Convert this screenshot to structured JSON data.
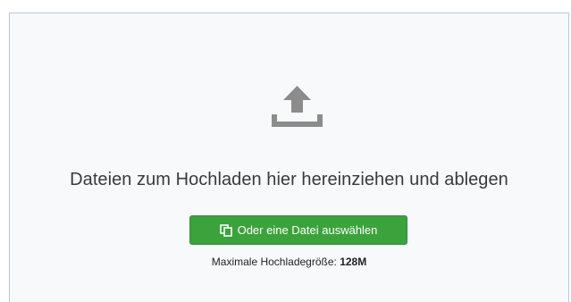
{
  "dropzone": {
    "instructions": "Dateien zum Hochladen hier hereinziehen und ablegen",
    "select_button_label": "Oder eine Datei auswählen",
    "max_size_label": "Maximale Hochladegröße:",
    "max_size_value": "128M",
    "upload_icon": "upload-icon",
    "button_icon": "copy-icon"
  },
  "colors": {
    "button_background": "#3ca23c",
    "dropzone_border": "#b9c7d8",
    "icon_gray": "#8c8c8c"
  }
}
